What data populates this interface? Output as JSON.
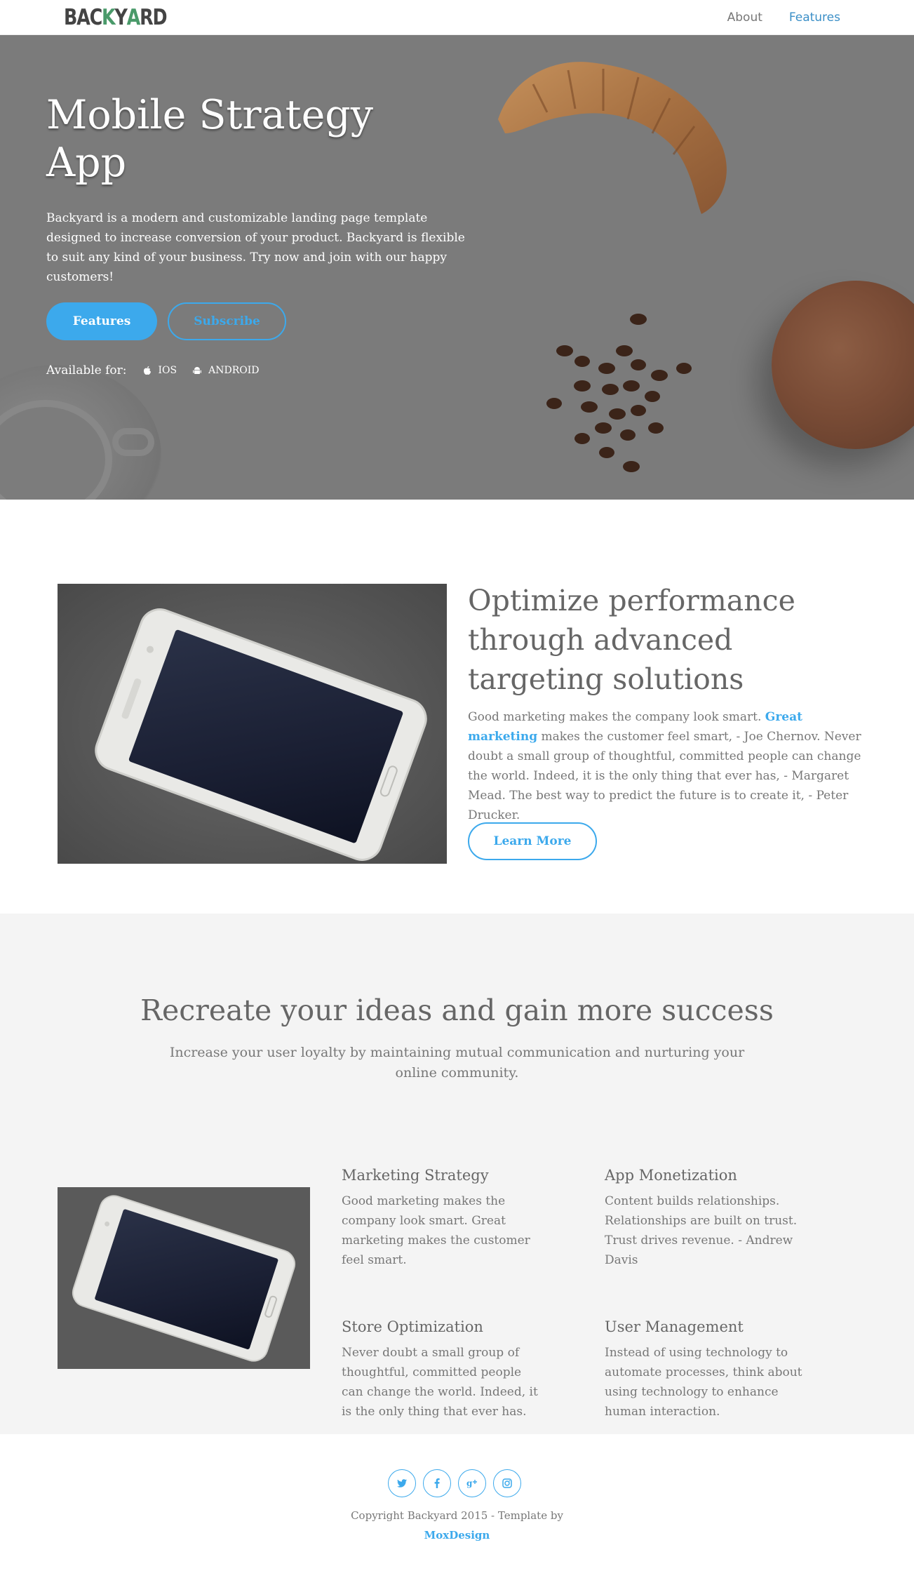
{
  "nav": {
    "logo": "BACKYARD",
    "links": [
      "About",
      "Features"
    ],
    "active": "Features"
  },
  "hero": {
    "title": "Mobile Strategy App",
    "description": "Backyard is a modern and customizable landing page template designed to increase conversion of your product. Backyard is flexible to suit any kind of your business. Try now and join with our happy customers!",
    "features_button": "Features",
    "subscribe_button": "Subscribe",
    "available_label": "Available for:",
    "platforms": [
      {
        "icon": "apple-icon",
        "label": "IOS"
      },
      {
        "icon": "android-icon",
        "label": "ANDROID"
      }
    ]
  },
  "section2": {
    "title": "Optimize performance through advanced targeting solutions",
    "text_before": "Good marketing makes the company look smart.",
    "highlight": "Great marketing",
    "text_after": "makes the customer feel smart, - Joe Chernov. Never doubt a small group of thoughtful, committed people can change the world. Indeed, it is the only thing that ever has, - Margaret Mead. The best way to predict the future is to create it, - Peter Drucker.",
    "button": "Learn More"
  },
  "section3": {
    "title": "Recreate your ideas and gain more success",
    "subtitle": "Increase your user loyalty by maintaining mutual communication and nurturing your online community.",
    "cards": [
      {
        "title": "Marketing Strategy",
        "text": "Good marketing makes the company look smart. Great marketing makes the customer feel smart."
      },
      {
        "title": "App Monetization",
        "text": "Content builds relationships. Relationships are built on trust. Trust drives revenue. - Andrew Davis"
      },
      {
        "title": "Store Optimization",
        "text": "Never doubt a small group of thoughtful, committed people can change the world. Indeed, it is the only thing that ever has."
      },
      {
        "title": "User Management",
        "text": "Instead of using technology to automate processes, think about using technology to enhance human interaction."
      }
    ]
  },
  "footer": {
    "social": [
      "twitter-icon",
      "facebook-icon",
      "google-plus-icon",
      "instagram-icon"
    ],
    "copyright": "Copyright Backyard 2015 - Template by",
    "author": "MoxDesign"
  },
  "colors": {
    "accent": "#3ca9ec",
    "hero_bg": "#7b7b7b",
    "section_bg": "#f4f4f4"
  }
}
